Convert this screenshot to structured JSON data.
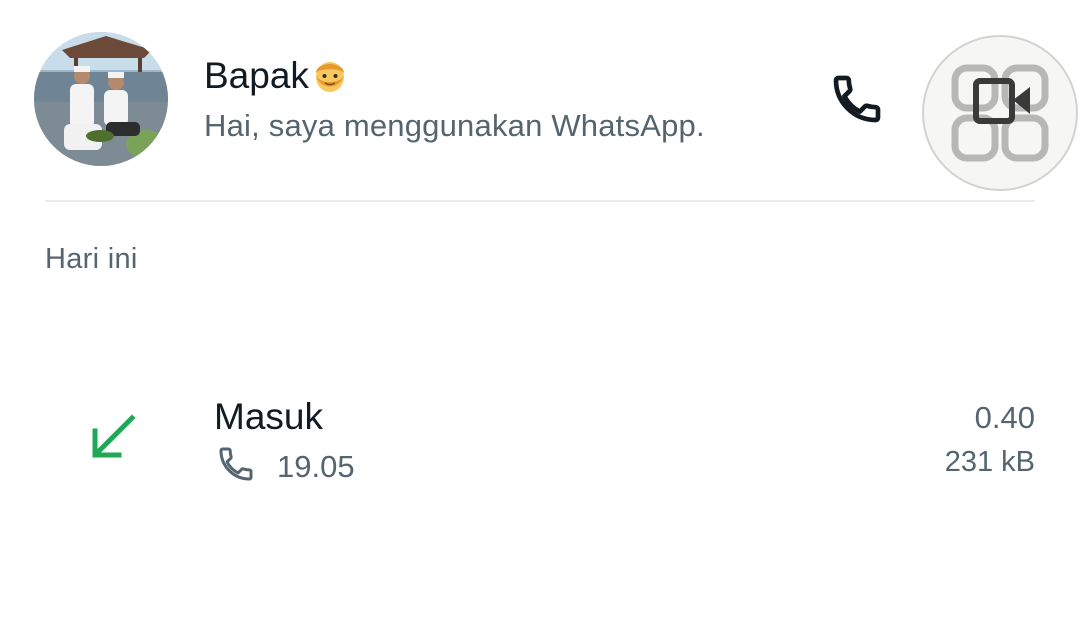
{
  "contact": {
    "name": "Bapak",
    "name_emoji_icon": "man-face-emoji-icon",
    "about": "Hai, saya menggunakan WhatsApp."
  },
  "actions": {
    "voice_call_icon": "phone-icon",
    "video_call_icon": "video-camera-icon"
  },
  "section": {
    "label": "Hari ini"
  },
  "calls": [
    {
      "direction_icon": "incoming-arrow-icon",
      "type": "Masuk",
      "time_icon": "phone-icon",
      "time": "19.05",
      "duration": "0.40",
      "size": "231 kB"
    }
  ],
  "colors": {
    "primary_text": "#111b21",
    "secondary_text": "#54656f",
    "incoming_green": "#1fa855",
    "divider": "#e9edef"
  }
}
